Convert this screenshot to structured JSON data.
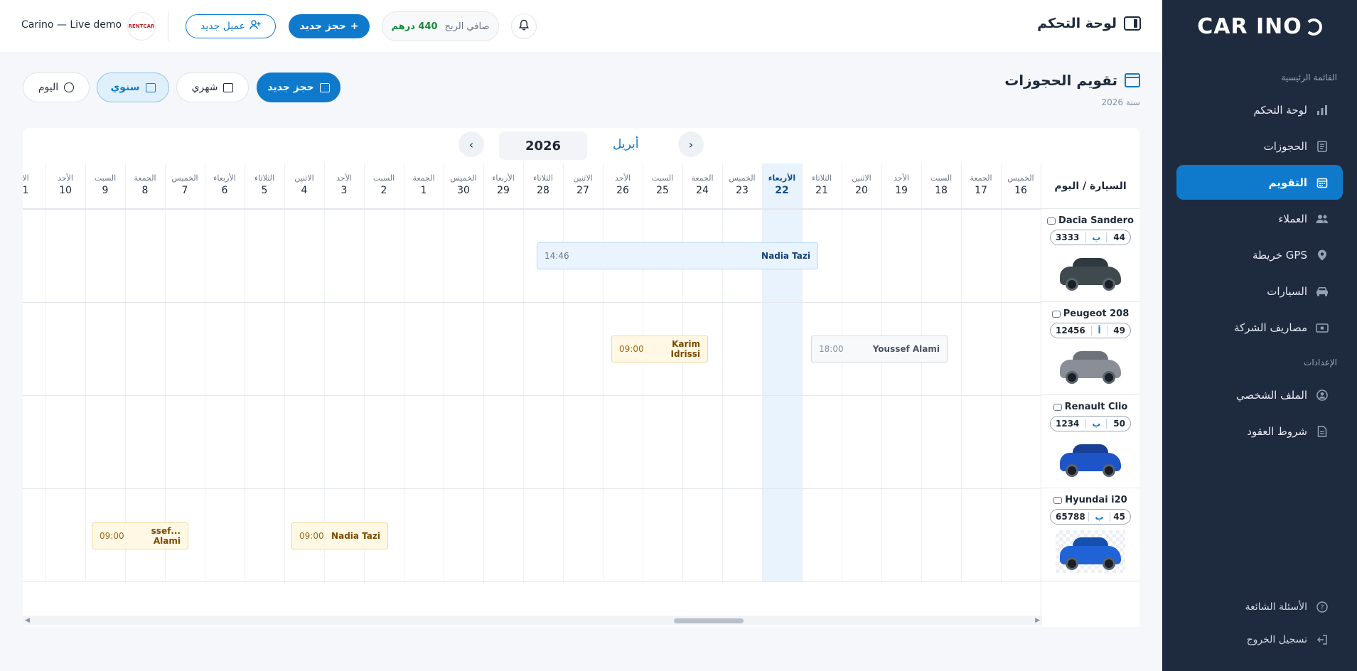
{
  "brand": {
    "logo_text": "CAR INO"
  },
  "sidebar": {
    "main_label": "القائمة الرئيسية",
    "items": [
      {
        "label": "لوحة التحكم",
        "icon": "bar-chart-icon"
      },
      {
        "label": "الحجوزات",
        "icon": "receipt-icon"
      },
      {
        "label": "التقويم",
        "icon": "calendar-icon",
        "active": true
      },
      {
        "label": "العملاء",
        "icon": "users-icon"
      },
      {
        "label": "GPS خريطة",
        "icon": "map-pin-icon"
      },
      {
        "label": "السيارات",
        "icon": "car-icon"
      },
      {
        "label": "مصاريف الشركة",
        "icon": "cash-icon"
      }
    ],
    "settings_label": "الإعدادات",
    "settings_items": [
      {
        "label": "الملف الشخصي",
        "icon": "user-circle-icon"
      },
      {
        "label": "شروط العقود",
        "icon": "document-icon"
      }
    ],
    "bottom_items": [
      {
        "label": "الأسئلة الشائعة",
        "icon": "help-icon"
      },
      {
        "label": "تسجيل الخروج",
        "icon": "logout-icon"
      }
    ]
  },
  "header": {
    "title": "لوحة التحكم",
    "profit_label": "صافي الربح",
    "profit_value": "440 درهم",
    "new_booking": "حجز جديد",
    "new_client": "عميل جديد",
    "avatar_text": "RENTCAR",
    "account_name": "Carino — Live demo"
  },
  "calendar": {
    "title": "تقويم الحجوزات",
    "subtitle": "سنة 2026",
    "buttons": {
      "new_booking": "حجز جديد",
      "monthly": "شهري",
      "yearly": "سنوي",
      "today": "اليوم"
    },
    "month": "أبريل",
    "year": "2026",
    "car_column_header": "السيارة / اليوم",
    "days": [
      {
        "name": "الخميس",
        "num": "16"
      },
      {
        "name": "الجمعة",
        "num": "17"
      },
      {
        "name": "السبت",
        "num": "18"
      },
      {
        "name": "الأحد",
        "num": "19"
      },
      {
        "name": "الاثنين",
        "num": "20"
      },
      {
        "name": "الثلاثاء",
        "num": "21"
      },
      {
        "name": "الأربعاء",
        "num": "22",
        "today": true
      },
      {
        "name": "الخميس",
        "num": "23"
      },
      {
        "name": "الجمعة",
        "num": "24"
      },
      {
        "name": "السبت",
        "num": "25"
      },
      {
        "name": "الأحد",
        "num": "26"
      },
      {
        "name": "الاثنين",
        "num": "27"
      },
      {
        "name": "الثلاثاء",
        "num": "28"
      },
      {
        "name": "الأربعاء",
        "num": "29"
      },
      {
        "name": "الخميس",
        "num": "30"
      },
      {
        "name": "الجمعة",
        "num": "1"
      },
      {
        "name": "السبت",
        "num": "2"
      },
      {
        "name": "الأحد",
        "num": "3"
      },
      {
        "name": "الاثنين",
        "num": "4"
      },
      {
        "name": "الثلاثاء",
        "num": "5"
      },
      {
        "name": "الأربعاء",
        "num": "6"
      },
      {
        "name": "الخميس",
        "num": "7"
      },
      {
        "name": "الجمعة",
        "num": "8"
      },
      {
        "name": "السبت",
        "num": "9"
      },
      {
        "name": "الأحد",
        "num": "10"
      },
      {
        "name": "الا",
        "num": "1"
      }
    ],
    "cars": [
      {
        "name": "Dacia Sandero",
        "plate_left": "44",
        "plate_mid": "ب",
        "plate_right": "3333",
        "color": "#3f4a4f"
      },
      {
        "name": "Peugeot 208",
        "plate_left": "49",
        "plate_mid": "أ",
        "plate_right": "12456",
        "color": "#8a8f97"
      },
      {
        "name": "Renault Clio",
        "plate_left": "50",
        "plate_mid": "ب",
        "plate_right": "1234",
        "color": "#1d55c9"
      },
      {
        "name": "Hyundai i20",
        "plate_left": "45",
        "plate_mid": "ب",
        "plate_right": "65788",
        "color": "#1f63d6"
      }
    ],
    "bookings": [
      {
        "name": "Nadia Tazi",
        "time": "14:46"
      },
      {
        "name": "Karim Idrissi",
        "time": "09:00"
      },
      {
        "name": "Youssef Alami",
        "time": "18:00"
      },
      {
        "name": "Nadia Tazi",
        "time": "09:00"
      },
      {
        "name": "...ssef Alami",
        "time": "09:00"
      }
    ]
  }
}
